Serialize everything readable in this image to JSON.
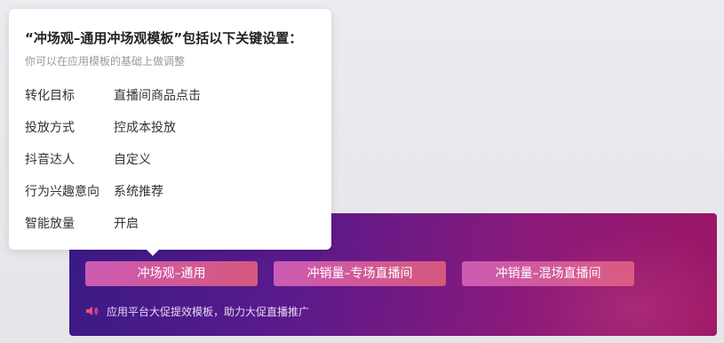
{
  "tooltip": {
    "title": "“冲场观–通用冲场观模板”包括以下关键设置：",
    "subtitle": "你可以在应用模板的基础上做调整",
    "settings": [
      {
        "key": "转化目标",
        "value": "直播间商品点击"
      },
      {
        "key": "投放方式",
        "value": "控成本投放"
      },
      {
        "key": "抖音达人",
        "value": "自定义"
      },
      {
        "key": "行为兴趣意向",
        "value": "系统推荐"
      },
      {
        "key": "智能放量",
        "value": "开启"
      }
    ]
  },
  "banner": {
    "templates": [
      {
        "label": "冲场观–通用"
      },
      {
        "label": "冲销量–专场直播间"
      },
      {
        "label": "冲销量–混场直播间"
      }
    ],
    "hint_text": "应用平台大促提效模板，助力大促直播推广",
    "hint_icon": "speaker-icon"
  },
  "colors": {
    "banner_start": "#3a1a86",
    "banner_end": "#9c1665",
    "button_start": "#cc5bb4",
    "button_end": "#d6587e",
    "speaker": "#e4507a"
  }
}
